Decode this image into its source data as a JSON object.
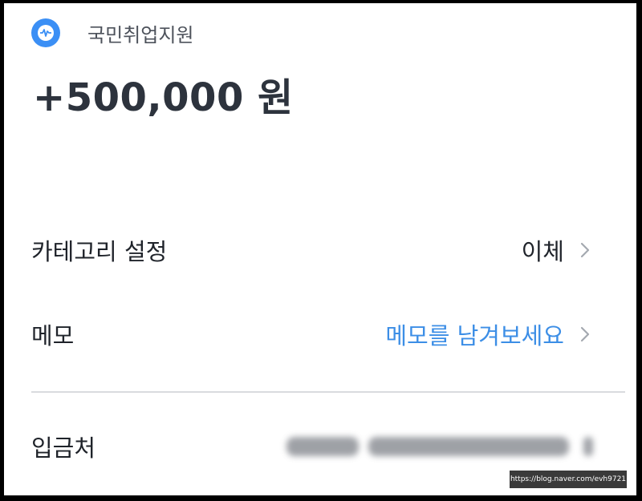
{
  "header": {
    "bank_name": "국민취업지원",
    "logo_icon": "wave-icon",
    "logo_color": "#3b8ff5"
  },
  "transaction": {
    "amount": "+500,000 원"
  },
  "rows": {
    "category": {
      "label": "카테고리 설정",
      "value": "이체"
    },
    "memo": {
      "label": "메모",
      "placeholder": "메모를 남겨보세요",
      "link_color": "#3c8ee6"
    },
    "depositor": {
      "label": "입금처"
    }
  },
  "watermark": "https://blog.naver.com/evh9721"
}
